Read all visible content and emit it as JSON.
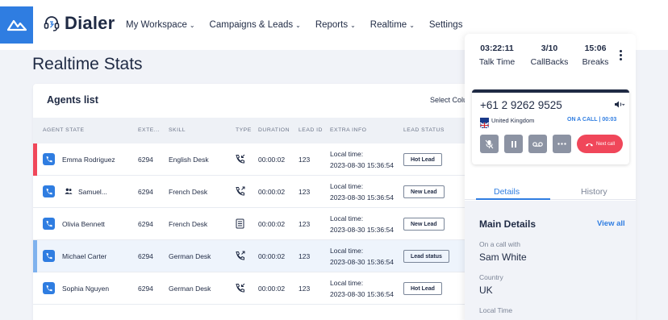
{
  "brand": {
    "name": "Dialer"
  },
  "nav": [
    {
      "label": "My Workspace",
      "chevron": true
    },
    {
      "label": "Campaigns & Leads",
      "chevron": true
    },
    {
      "label": "Reports",
      "chevron": true
    },
    {
      "label": "Realtime",
      "chevron": true
    },
    {
      "label": "Settings",
      "chevron": false
    }
  ],
  "page": {
    "title": "Realtime Stats"
  },
  "agents": {
    "title": "Agents list",
    "select_columns": "Select Colu",
    "columns": [
      "AGENT STATE",
      "EXTE...",
      "SKILL",
      "TYPE",
      "DURATION",
      "LEAD ID",
      "EXTRA INFO",
      "LEAD STATUS"
    ],
    "rows": [
      {
        "name": "Emma Rodriguez",
        "ext": "6294",
        "skill": "English Desk",
        "type_icon": "phone-incoming-icon",
        "duration": "00:00:02",
        "lead_id": "123",
        "info_line1": "Local time:",
        "info_line2": "2023-08-30 15:36:54",
        "status": "Hot Lead",
        "bar_color": "#f0475a",
        "highlight": false,
        "group": false
      },
      {
        "name": "Samuel...",
        "ext": "6294",
        "skill": "French Desk",
        "type_icon": "phone-outgoing-icon",
        "duration": "00:00:02",
        "lead_id": "123",
        "info_line1": "Local time:",
        "info_line2": "2023-08-30 15:36:54",
        "status": "New Lead",
        "bar_color": "",
        "highlight": false,
        "group": true
      },
      {
        "name": "Olivia Bennett",
        "ext": "6294",
        "skill": "French Desk",
        "type_icon": "document-icon",
        "duration": "00:00:02",
        "lead_id": "123",
        "info_line1": "Local time:",
        "info_line2": "2023-08-30 15:36:54",
        "status": "New Lead",
        "bar_color": "",
        "highlight": false,
        "group": false
      },
      {
        "name": "Michael Carter",
        "ext": "6294",
        "skill": "German Desk",
        "type_icon": "phone-outgoing-icon",
        "duration": "00:00:02",
        "lead_id": "123",
        "info_line1": "Local time:",
        "info_line2": "2023-08-30 15:36:54",
        "status": "Lead status",
        "bar_color": "#7fb2ee",
        "highlight": true,
        "group": false
      },
      {
        "name": "Sophia Nguyen",
        "ext": "6294",
        "skill": "German Desk",
        "type_icon": "phone-incoming-icon",
        "duration": "00:00:02",
        "lead_id": "123",
        "info_line1": "Local time:",
        "info_line2": "2023-08-30 15:36:54",
        "status": "Hot Lead",
        "bar_color": "",
        "highlight": false,
        "group": false
      }
    ]
  },
  "call_panel": {
    "stats": [
      {
        "value": "03:22:11",
        "label": "Talk Time"
      },
      {
        "value": "3/10",
        "label": "CallBacks"
      },
      {
        "value": "15:06",
        "label": "Breaks"
      }
    ],
    "phone_number": "+61 2 9262 9525",
    "country": "United Kingdom",
    "on_call_label": "ON A CALL",
    "on_call_time": "00:03",
    "next_call_label": "Next call",
    "tabs": [
      "Details",
      "History"
    ],
    "details_title": "Main Details",
    "view_all": "View all",
    "fields": [
      {
        "label": "On a call with",
        "value": "Sam White"
      },
      {
        "label": "Country",
        "value": "UK"
      },
      {
        "label": "Local Time",
        "value": ""
      }
    ]
  },
  "colors": {
    "accent": "#2f7de1",
    "danger": "#f0475a",
    "text": "#1f2a44"
  }
}
